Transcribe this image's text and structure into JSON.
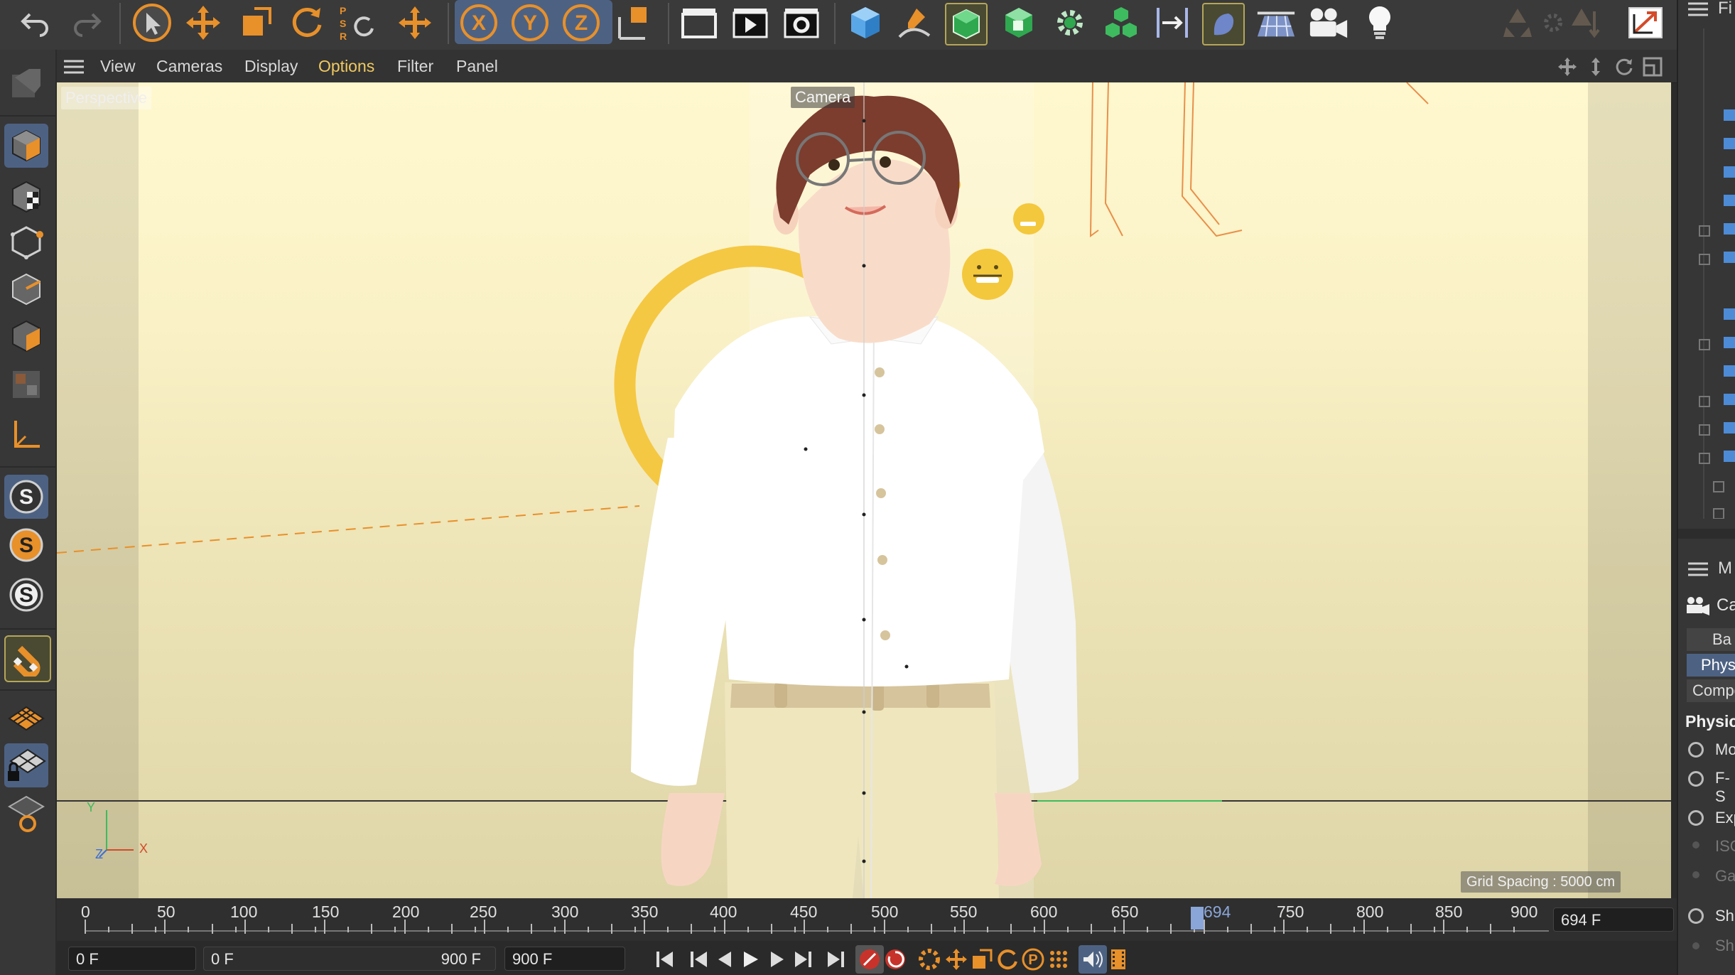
{
  "viewport_menu": {
    "items": [
      "View",
      "Cameras",
      "Display",
      "Options",
      "Filter",
      "Panel"
    ],
    "highlighted": "Options"
  },
  "viewport": {
    "mode_label": "Perspective",
    "camera_label": "Camera",
    "grid_spacing": "Grid Spacing : 5000 cm",
    "axis_labels": {
      "x": "X",
      "y": "Y",
      "z": "Z"
    }
  },
  "timeline": {
    "ticks": [
      "0",
      "50",
      "100",
      "150",
      "200",
      "250",
      "300",
      "350",
      "400",
      "450",
      "500",
      "550",
      "600",
      "650",
      "694",
      "750",
      "800",
      "850",
      "900"
    ],
    "current_frame_marker": "694",
    "current_frame_field": "694 F"
  },
  "transport": {
    "start_field": "0 F",
    "range_start": "0 F",
    "range_end": "900 F",
    "end_field": "900 F"
  },
  "right_panel": {
    "attr_title_partial": "M",
    "object_partial": "Ca",
    "tabs_partial": [
      "Ba",
      "Phys",
      "Compo"
    ],
    "active_tab_partial": "Phys",
    "section_partial": "Physic",
    "options_partial": [
      "Mo",
      "F-S",
      "Exp",
      "ISO",
      "Ga",
      "Sh",
      "Sh"
    ],
    "top_partial": "Fi"
  },
  "colors": {
    "toolbar_bg": "#3a3a3a",
    "active_blue": "#4d6283",
    "accent_orange": "#e8902a",
    "highlight_yellow": "#f0c960"
  }
}
